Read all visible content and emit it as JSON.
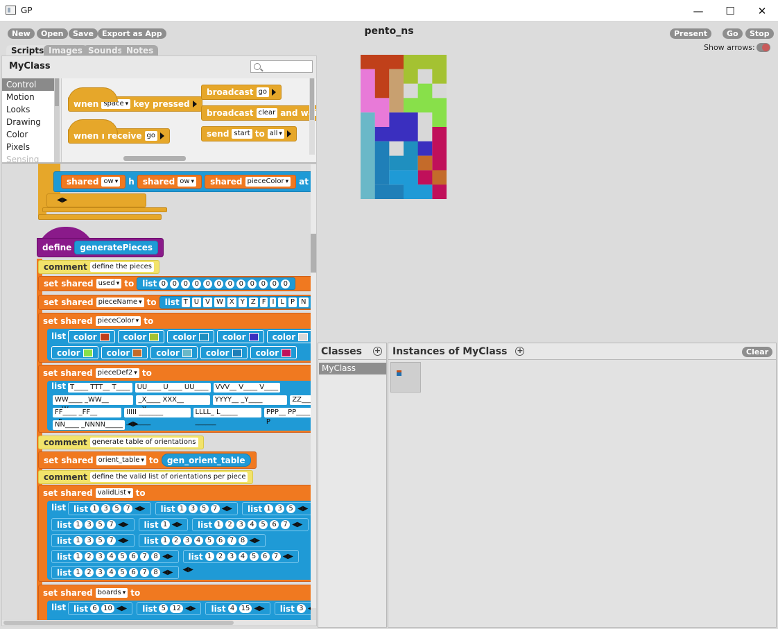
{
  "window": {
    "title": "GP",
    "minimize": "—",
    "maximize": "☐",
    "close": "✕"
  },
  "toolbar": {
    "new": "New",
    "open": "Open",
    "save": "Save",
    "export": "Export as App",
    "project_name": "pento_ns",
    "present": "Present",
    "go": "Go",
    "stop": "Stop",
    "show_arrows": "Show arrows:"
  },
  "tabs": [
    "Scripts",
    "Images",
    "Sounds",
    "Notes"
  ],
  "palette": {
    "class_name": "MyClass",
    "search_placeholder": "",
    "categories": [
      "Control",
      "Motion",
      "Looks",
      "Drawing",
      "Color",
      "Pixels",
      "Sensing"
    ],
    "blocks": {
      "when": "when",
      "key_val": "space",
      "key_pressed": "key pressed",
      "when_receive": "when I receive",
      "receive_val": "go",
      "broadcast": "broadcast",
      "broadcast_val": "go",
      "broadcast2": "broadcast",
      "broadcast2_val": "clear",
      "and_wait": "and wait",
      "send": "send",
      "send_val": "start",
      "to": "to",
      "to_val": "all"
    }
  },
  "script": {
    "shared": "shared",
    "ow": "ow",
    "h": "h",
    "pieceColor": "pieceColor",
    "at": "at",
    "define": "define",
    "func_name": "generatePieces",
    "comment": "comment",
    "comment1": "define the pieces",
    "set_shared": "set shared",
    "to": "to",
    "list": "list",
    "color": "color",
    "used": "used",
    "used_vals": [
      "0",
      "0",
      "0",
      "0",
      "0",
      "0",
      "0",
      "0",
      "0",
      "0",
      "0",
      "0"
    ],
    "pieceName": "pieceName",
    "names": [
      "T",
      "U",
      "V",
      "W",
      "X",
      "Y",
      "Z",
      "F",
      "I",
      "L",
      "P",
      "N"
    ],
    "colors": [
      "#c0401a",
      "#a4c232",
      "#1f8fbf",
      "#3a2fbf",
      "#d8d8d8",
      "#88e04a",
      "#c46b2a",
      "#6ab8c8",
      "#1f7fb8",
      "#c0105a"
    ],
    "pieceDef2": "pieceDef2",
    "defs_row1": [
      "T____ TTT__ T____",
      "UU____ U____ UU____",
      "VVV__ V____ V____"
    ],
    "defs_row2": [
      "WW____ _WW__ __W__",
      "_X____ XXX__ _X____",
      "YYYY__ _Y____ ______",
      "ZZ____"
    ],
    "defs_row3": [
      "FF____ _FF__ _F____",
      "IIIII _______ _______",
      "LLLL_ L_____ ______",
      "PPP__ PP____ P"
    ],
    "defs_row4": [
      "NN____ _NNNN_____"
    ],
    "comment2": "generate table of orientations",
    "orient_table": "orient_table",
    "gen_orient": "gen_orient_table",
    "comment3": "define the valid list of orientations per piece",
    "validList": "validList",
    "vl": {
      "r1": [
        [
          "1",
          "3",
          "5",
          "7"
        ],
        [
          "1",
          "3",
          "5",
          "7"
        ],
        [
          "1",
          "3",
          "5"
        ]
      ],
      "r2": [
        [
          "1",
          "3",
          "5",
          "7"
        ],
        [
          "1"
        ],
        [
          "1",
          "2",
          "3",
          "4",
          "5",
          "6",
          "7"
        ]
      ],
      "r3": [
        [
          "1",
          "3",
          "5",
          "7"
        ],
        [
          "1",
          "2",
          "3",
          "4",
          "5",
          "6",
          "7",
          "8"
        ]
      ],
      "r4": [
        [
          "1",
          "2",
          "3",
          "4",
          "5",
          "6",
          "7",
          "8"
        ],
        [
          "1",
          "2",
          "3",
          "4",
          "5",
          "6",
          "7"
        ]
      ],
      "r5": [
        [
          "1",
          "2",
          "3",
          "4",
          "5",
          "6",
          "7",
          "8"
        ]
      ]
    },
    "boards": "boards",
    "bd": [
      [
        "6",
        "10"
      ],
      [
        "5",
        "12"
      ],
      [
        "4",
        "15"
      ],
      [
        "3"
      ]
    ]
  },
  "panes": {
    "classes": "Classes",
    "instances": "Instances of MyClass",
    "class_item": "MyClass",
    "clear": "Clear"
  }
}
